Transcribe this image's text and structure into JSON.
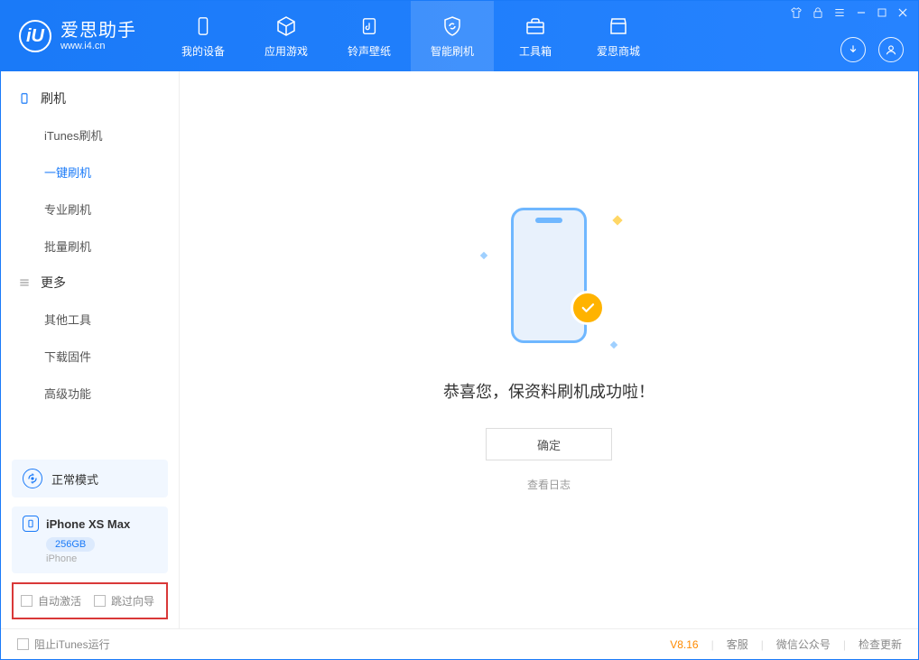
{
  "app": {
    "name": "爱思助手",
    "url": "www.i4.cn"
  },
  "tabs": [
    {
      "label": "我的设备"
    },
    {
      "label": "应用游戏"
    },
    {
      "label": "铃声壁纸"
    },
    {
      "label": "智能刷机"
    },
    {
      "label": "工具箱"
    },
    {
      "label": "爱思商城"
    }
  ],
  "sidebar": {
    "group1": {
      "title": "刷机",
      "items": [
        "iTunes刷机",
        "一键刷机",
        "专业刷机",
        "批量刷机"
      ]
    },
    "group2": {
      "title": "更多",
      "items": [
        "其他工具",
        "下载固件",
        "高级功能"
      ]
    }
  },
  "mode": {
    "label": "正常模式"
  },
  "device": {
    "name": "iPhone XS Max",
    "storage": "256GB",
    "type": "iPhone"
  },
  "options": {
    "auto_activate": "自动激活",
    "skip_guide": "跳过向导"
  },
  "main": {
    "message": "恭喜您，保资料刷机成功啦！",
    "ok": "确定",
    "view_log": "查看日志"
  },
  "footer": {
    "block_itunes": "阻止iTunes运行",
    "version": "V8.16",
    "support": "客服",
    "wechat": "微信公众号",
    "update": "检查更新"
  }
}
